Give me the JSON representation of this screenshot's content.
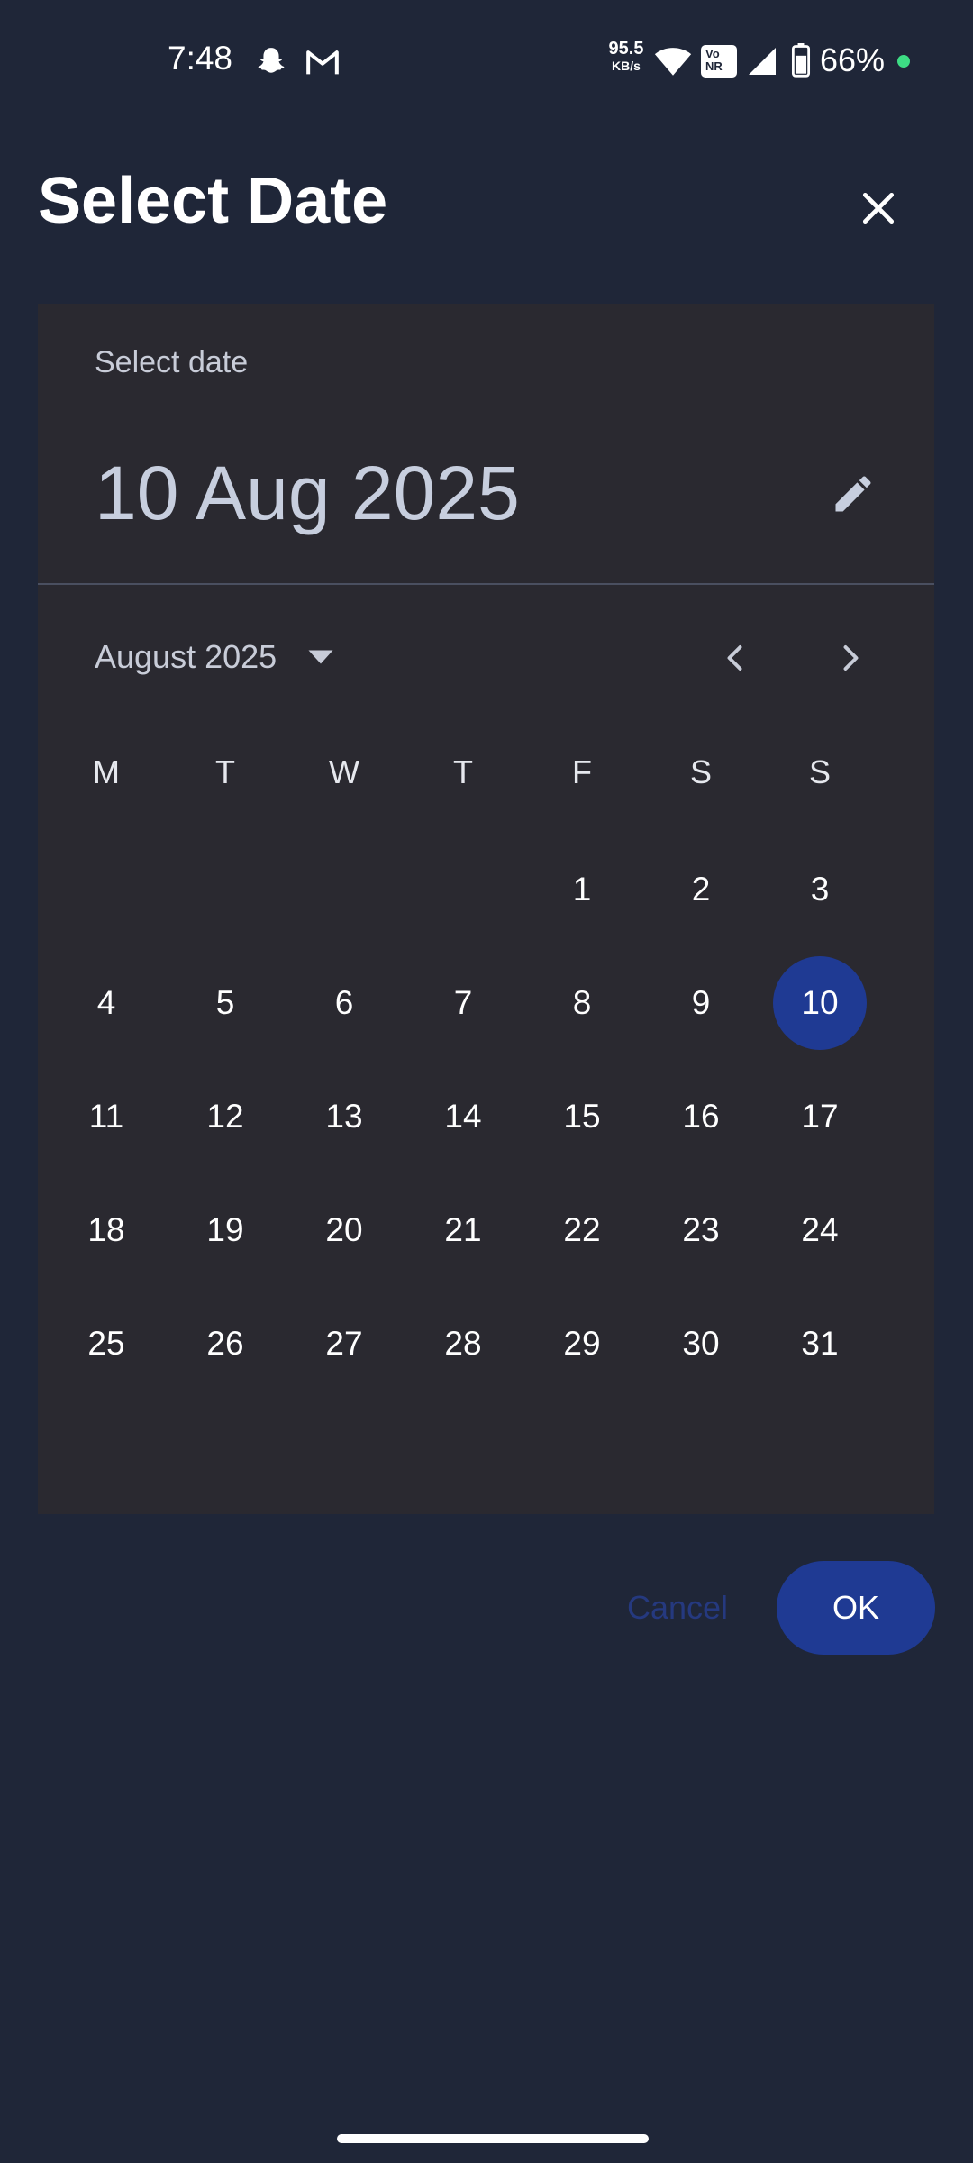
{
  "status_bar": {
    "time": "7:48",
    "network_speed_value": "95.5",
    "network_speed_unit": "KB/s",
    "volte_badge": "Vo NR",
    "battery_percent": "66%",
    "icons": [
      "snapchat-icon",
      "gmail-icon",
      "wifi-icon",
      "vonr-icon",
      "signal-icon",
      "battery-icon"
    ]
  },
  "header": {
    "title": "Select Date",
    "close_icon": "close-icon"
  },
  "picker": {
    "subtitle": "Select date",
    "selected_date": "10 Aug 2025",
    "edit_icon": "pencil-icon",
    "month_year": "August 2025",
    "weekdays": [
      "M",
      "T",
      "W",
      "T",
      "F",
      "S",
      "S"
    ],
    "weeks": [
      [
        "",
        "",
        "",
        "",
        "1",
        "2",
        "3"
      ],
      [
        "4",
        "5",
        "6",
        "7",
        "8",
        "9",
        "10"
      ],
      [
        "11",
        "12",
        "13",
        "14",
        "15",
        "16",
        "17"
      ],
      [
        "18",
        "19",
        "20",
        "21",
        "22",
        "23",
        "24"
      ],
      [
        "25",
        "26",
        "27",
        "28",
        "29",
        "30",
        "31"
      ]
    ],
    "selected_day": "10"
  },
  "actions": {
    "cancel_label": "Cancel",
    "ok_label": "OK"
  },
  "colors": {
    "background": "#1f2638",
    "card": "#2a2930",
    "accent": "#1f3a93",
    "cancel_text": "#25397f",
    "status_dot": "#3ddc84"
  }
}
